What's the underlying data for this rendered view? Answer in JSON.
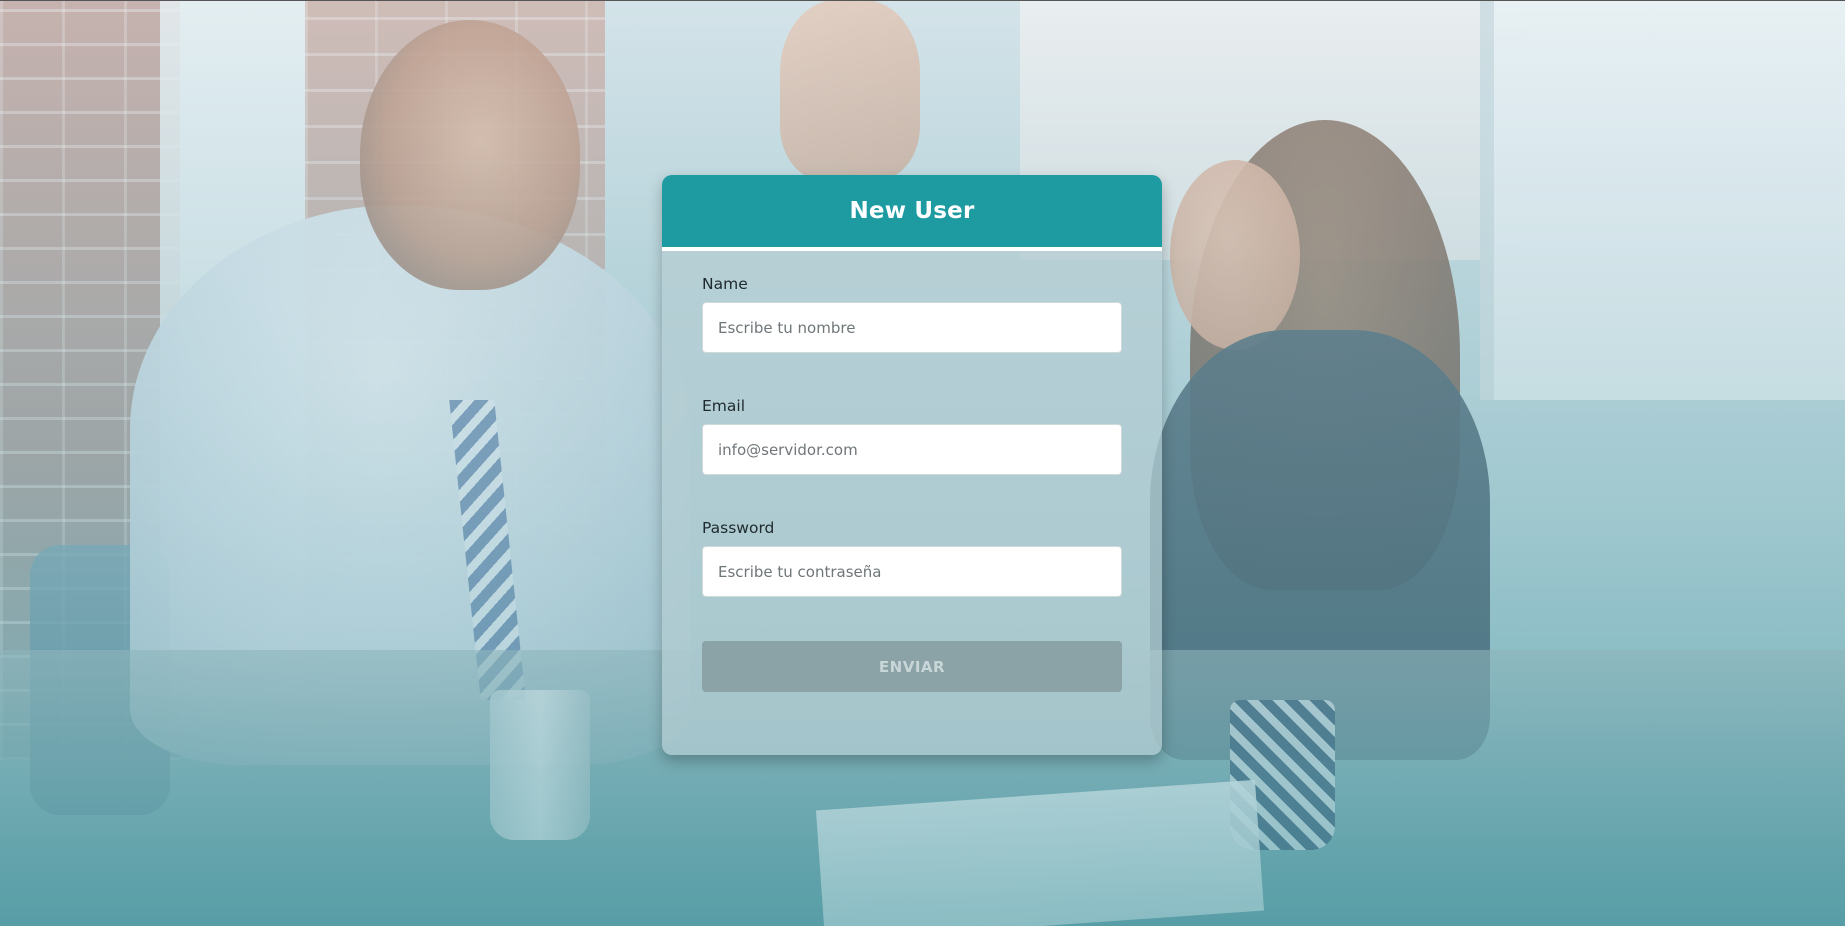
{
  "form": {
    "title": "New User",
    "fields": [
      {
        "label": "Name",
        "placeholder": "Escribe tu nombre",
        "value": ""
      },
      {
        "label": "Email",
        "placeholder": "info@servidor.com",
        "value": ""
      },
      {
        "label": "Password",
        "placeholder": "Escribe tu contraseña",
        "value": ""
      }
    ],
    "submit_label": "ENVIAR"
  },
  "colors": {
    "header": "#1e9aa1",
    "button_disabled": "#8ba3a7",
    "card_translucent": "rgba(180,205,210,0.72)"
  },
  "background": {
    "description_icon": "office-high-five-photo"
  }
}
